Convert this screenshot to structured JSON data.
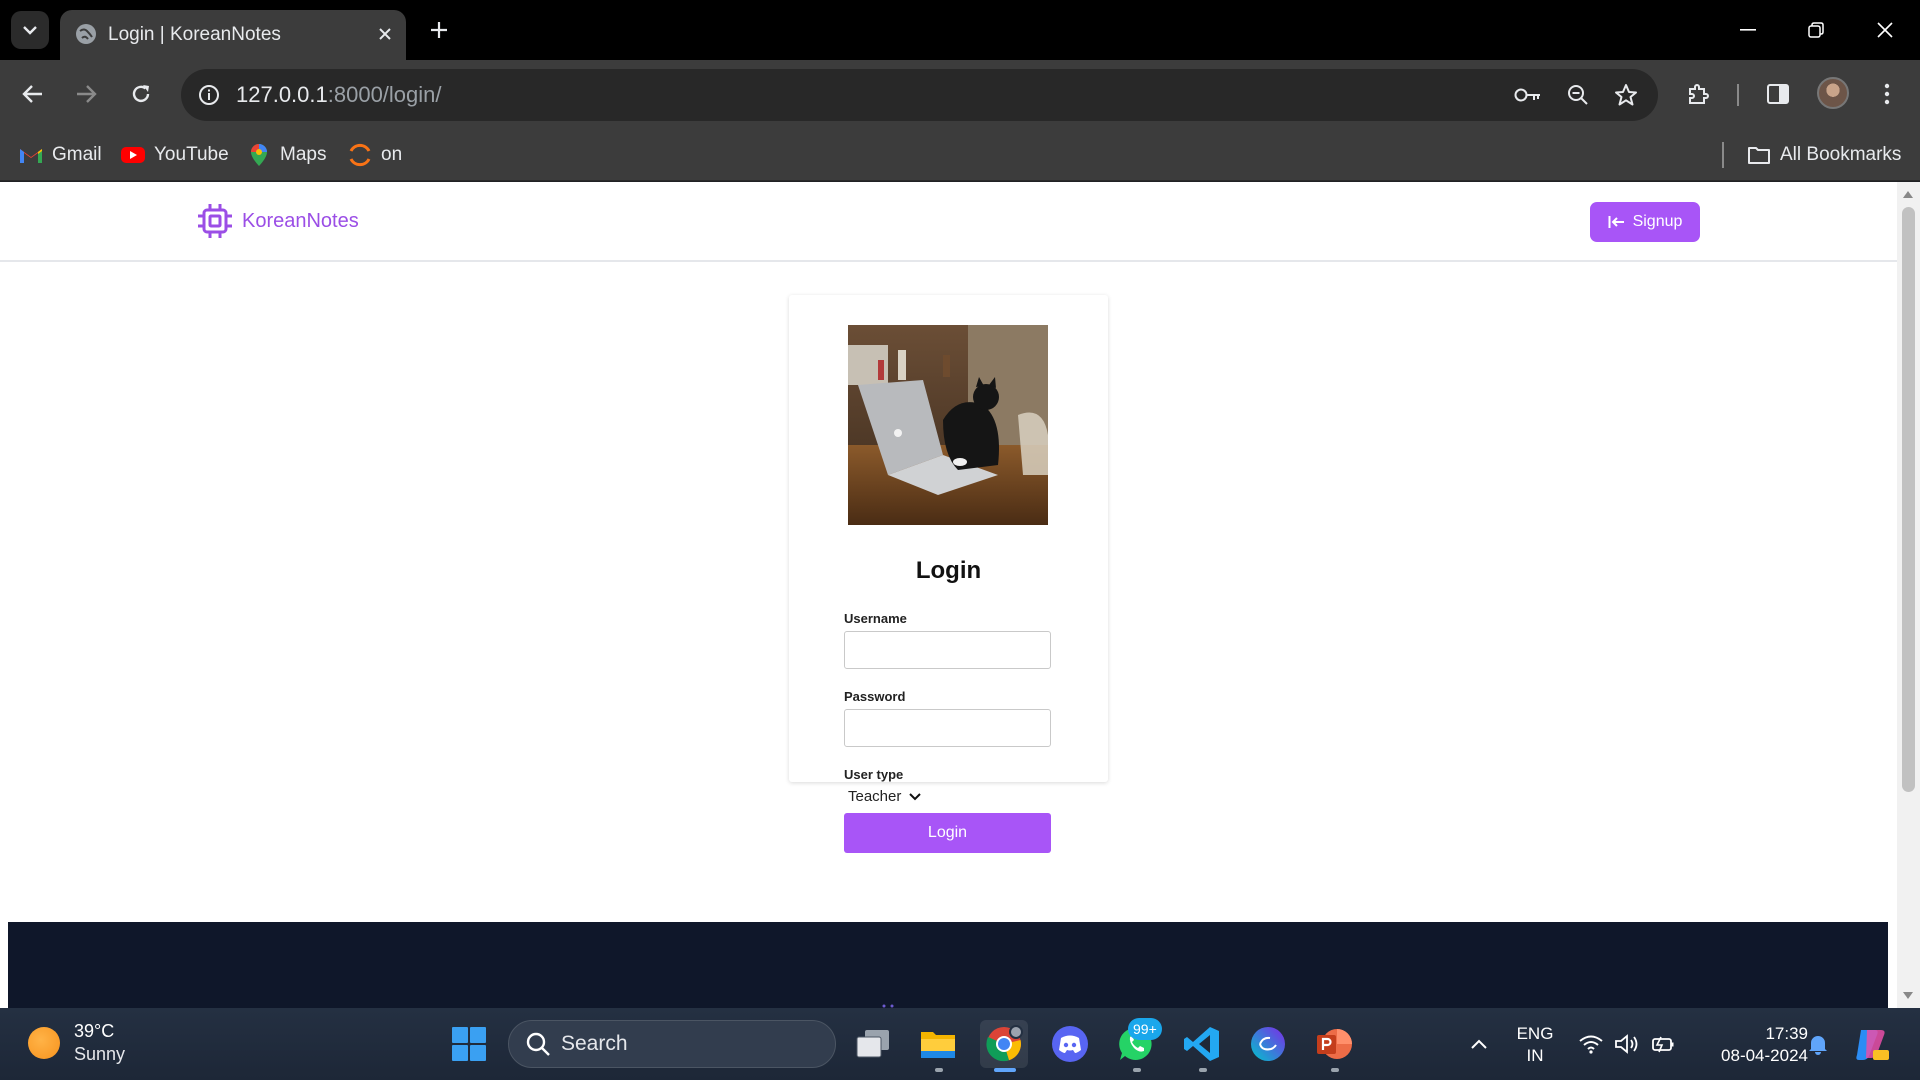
{
  "browser": {
    "tab_title": "Login | KoreanNotes",
    "url_host": "127.0.0.1",
    "url_rest": ":8000/login/",
    "bookmarks": [
      {
        "label": "Gmail",
        "icon": "gmail-icon"
      },
      {
        "label": "YouTube",
        "icon": "youtube-icon"
      },
      {
        "label": "Maps",
        "icon": "maps-icon"
      },
      {
        "label": "on",
        "icon": "orange-arc-icon"
      }
    ],
    "all_bookmarks_label": "All Bookmarks"
  },
  "site": {
    "brand": "KoreanNotes",
    "signup_label": "Signup",
    "accent_color": "#a855f7",
    "footer_color": "#0f172a"
  },
  "login": {
    "heading": "Login",
    "username_label": "Username",
    "username_value": "",
    "password_label": "Password",
    "password_value": "",
    "user_type_label": "User type",
    "user_type_selected": "Teacher",
    "submit_label": "Login"
  },
  "taskbar": {
    "weather_temp": "39°C",
    "weather_desc": "Sunny",
    "search_placeholder": "Search",
    "whatsapp_badge": "99+",
    "language_line1": "ENG",
    "language_line2": "IN",
    "time": "17:39",
    "date": "08-04-2024"
  }
}
